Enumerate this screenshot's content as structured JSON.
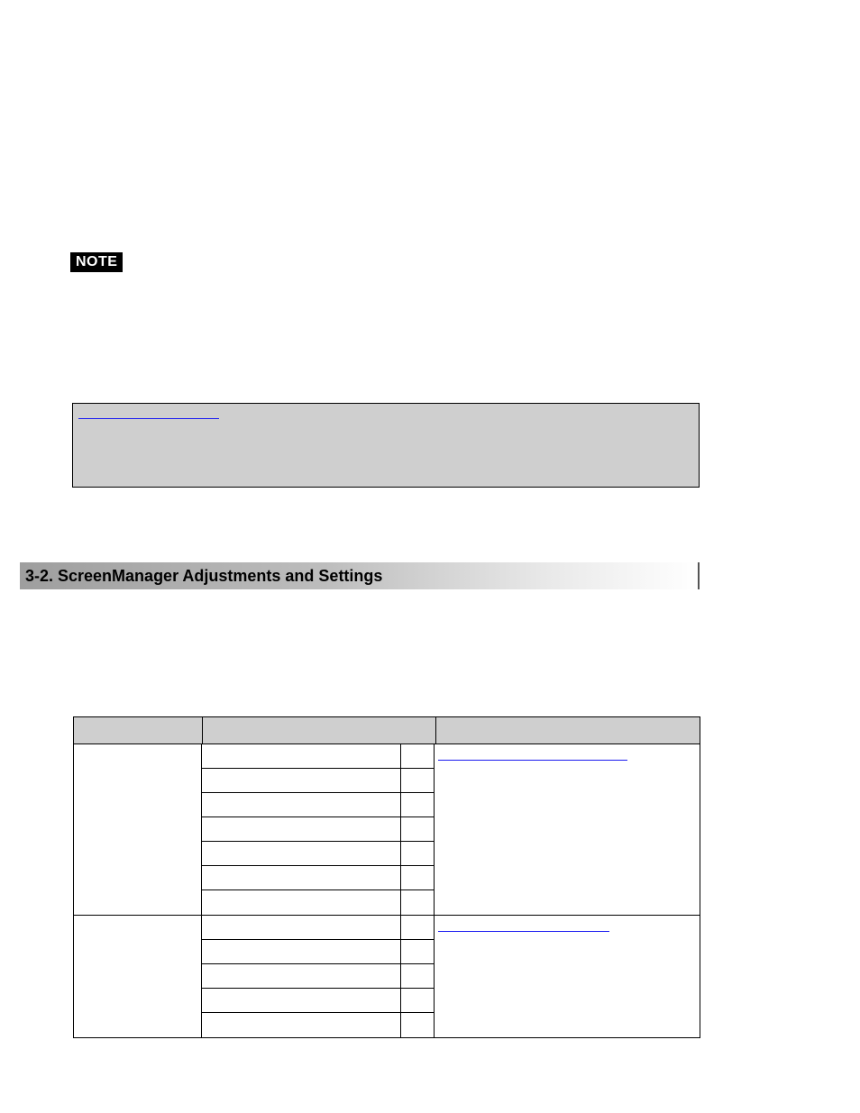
{
  "note_badge": "NOTE",
  "section_heading": "3-2. ScreenManager Adjustments and Settings",
  "greybox_link_text": "",
  "table": {
    "headers": {
      "main": "",
      "sub": "",
      "ref": ""
    },
    "groups": [
      {
        "main": "",
        "ref_link": "",
        "subs": [
          {
            "label": "",
            "icon": ""
          },
          {
            "label": "",
            "icon": ""
          },
          {
            "label": "",
            "icon": ""
          },
          {
            "label": "",
            "icon": ""
          },
          {
            "label": "",
            "icon": ""
          },
          {
            "label": "",
            "icon": ""
          },
          {
            "label": "",
            "icon": ""
          }
        ]
      },
      {
        "main": "",
        "ref_link": "",
        "subs": [
          {
            "label": "",
            "icon": ""
          },
          {
            "label": "",
            "icon": ""
          },
          {
            "label": "",
            "icon": ""
          },
          {
            "label": "",
            "icon": ""
          },
          {
            "label": "",
            "icon": ""
          }
        ]
      }
    ]
  }
}
